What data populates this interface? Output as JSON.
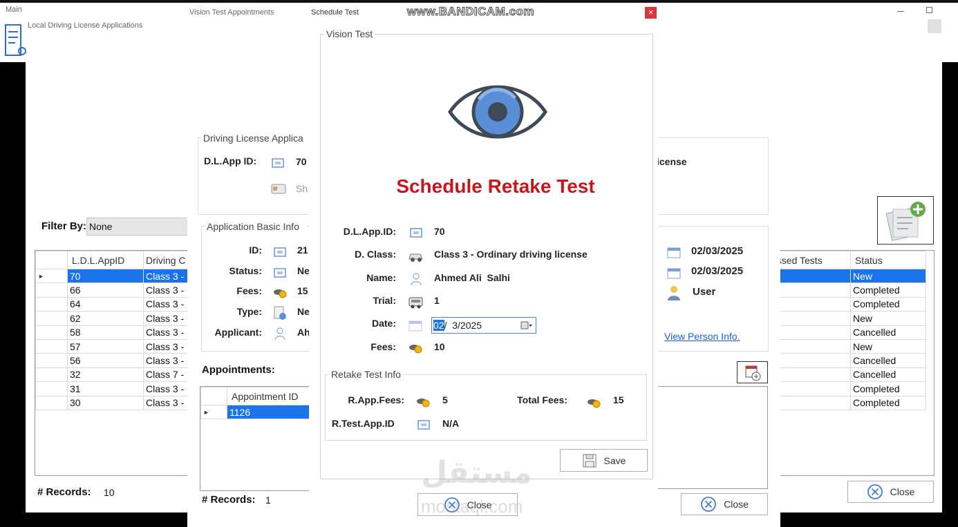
{
  "top_bar": {
    "watermark": "www.BANDICAM.com"
  },
  "main_window": {
    "title": "Main",
    "subtitle": "Local Driving License Applications"
  },
  "ldla": {
    "filter_label": "Filter By:",
    "filter_value": "None",
    "columns": [
      "L.D.L.AppID",
      "Driving C",
      "assed Tests",
      "Status"
    ],
    "rows": [
      {
        "id": "70",
        "cls": "Class 3 -",
        "status": "New"
      },
      {
        "id": "66",
        "cls": "Class 3 -",
        "status": "Completed"
      },
      {
        "id": "64",
        "cls": "Class 3 -",
        "status": "Completed"
      },
      {
        "id": "62",
        "cls": "Class 3 -",
        "status": "New"
      },
      {
        "id": "58",
        "cls": "Class 3 -",
        "status": "Cancelled"
      },
      {
        "id": "57",
        "cls": "Class 3 -",
        "status": "New"
      },
      {
        "id": "56",
        "cls": "Class 3 -",
        "status": "Cancelled"
      },
      {
        "id": "32",
        "cls": "Class 7 -",
        "status": "Cancelled"
      },
      {
        "id": "31",
        "cls": "Class 3 -",
        "status": "Completed"
      },
      {
        "id": "30",
        "cls": "Class 3 -",
        "status": "Completed"
      }
    ],
    "records_label": "# Records:",
    "records_value": "10",
    "close_label": "Close"
  },
  "vta": {
    "title": "Vision Test Appointments",
    "dl_group": "Driving License Applica",
    "dl_app_id_label": "D.L.App ID:",
    "dl_app_id_value": "70",
    "show_label": "Sh",
    "license_text": "icense",
    "basic_group": "Application Basic Info",
    "id_label": "ID:",
    "id_value": "21",
    "status_label": "Status:",
    "status_value": "Ne",
    "fees_label": "Fees:",
    "fees_value": "15",
    "type_label": "Type:",
    "type_value": "Ne",
    "applicant_label": "Applicant:",
    "applicant_value": "Ah",
    "date1": "02/03/2025",
    "date2": "02/03/2025",
    "user": "User",
    "view_person": "View Person Info.",
    "appointments_label": "Appointments:",
    "appt_column": "Appointment ID",
    "appt_rows": [
      "1126"
    ],
    "records_label": "# Records:",
    "records_value": "1",
    "close_label": "Close"
  },
  "schedule": {
    "window_title": "Schedule Test",
    "group_title": "Vision Test",
    "heading": "Schedule Retake Test",
    "dl_app_id_label": "D.L.App.ID:",
    "dl_app_id_value": "70",
    "class_label": "D. Class:",
    "class_value": "Class 3 - Ordinary driving license",
    "name_label": "Name:",
    "name_value": "Ahmed Ali  Salhi",
    "trial_label": "Trial:",
    "trial_value": "1",
    "date_label": "Date:",
    "date_sel": "02",
    "date_rest": "/  3/2025",
    "fees_label": "Fees:",
    "fees_value": "10",
    "retake_group": "Retake Test Info",
    "rapp_fees_label": "R.App.Fees:",
    "rapp_fees_value": "5",
    "total_fees_label": "Total Fees:",
    "total_fees_value": "15",
    "rtest_label": "R.Test.App.ID",
    "rtest_value": "N/A",
    "save_label": "Save",
    "close_label": "Close",
    "close_x": "×"
  },
  "bottom_watermark": {
    "arabic": "مستقل",
    "latin": "mostaql.com"
  },
  "colors": {
    "accent": "#1a73e8",
    "heading_red": "#c8161d",
    "eye_blue": "#5a8fd8"
  }
}
